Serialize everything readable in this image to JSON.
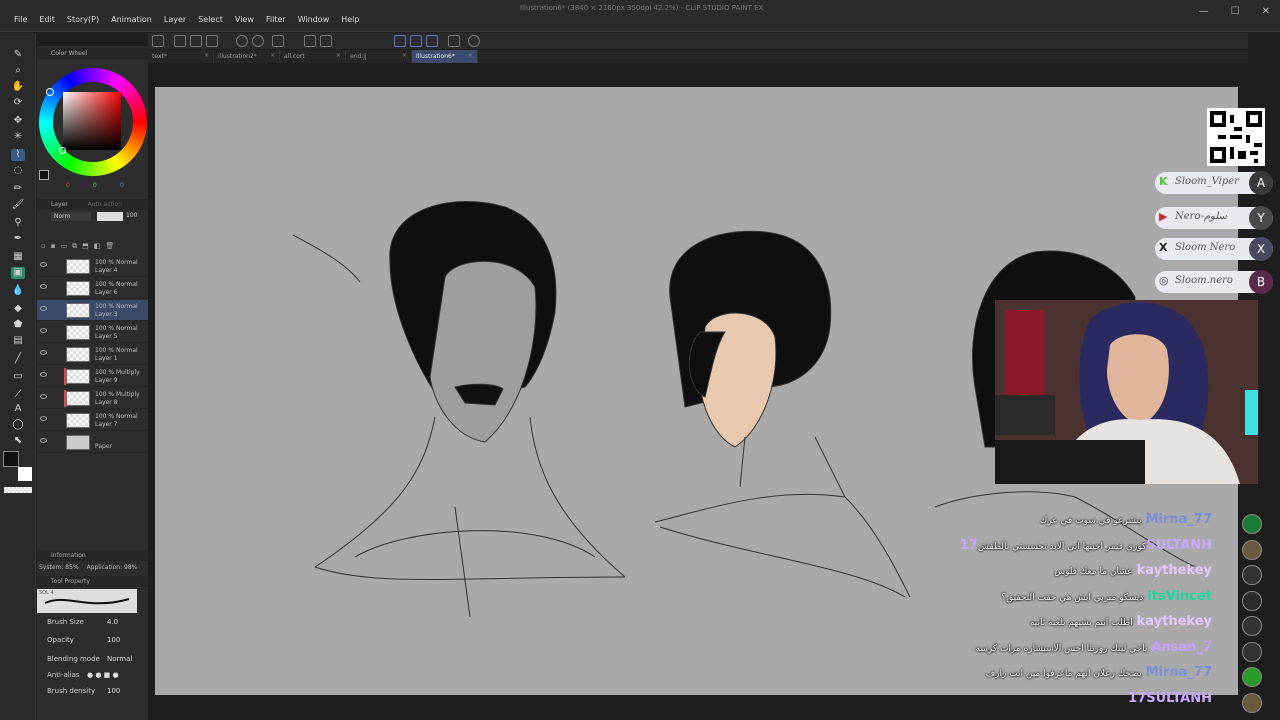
{
  "window": {
    "title": "Illustration6* (3840 × 2160px 350dpi 42.2%) - CLIP STUDIO PAINT EX"
  },
  "menu": [
    "File",
    "Edit",
    "Story(P)",
    "Animation",
    "Layer",
    "Select",
    "View",
    "Filter",
    "Window",
    "Help"
  ],
  "tabs": [
    {
      "label": "text*"
    },
    {
      "label": "illustration2*"
    },
    {
      "label": "all.cort"
    },
    {
      "label": "end.jj"
    },
    {
      "label": "Illustration6*"
    }
  ],
  "color_panel": {
    "title": "Color Wheel",
    "values": [
      "0",
      "0",
      "0"
    ],
    "main_color": "#1a1a1a",
    "sub_color": "#ffffff"
  },
  "layer_panel": {
    "tabs": [
      "Layer",
      "Auto action"
    ],
    "blend_mode": "Norm",
    "opacity": "100",
    "layers": [
      {
        "line1": "100 % Normal",
        "line2": "Layer 4"
      },
      {
        "line1": "100 % Normal",
        "line2": "Layer 6"
      },
      {
        "line1": "100 % Normal",
        "line2": "Layer 3",
        "selected": true
      },
      {
        "line1": "100 % Normal",
        "line2": "Layer 5"
      },
      {
        "line1": "100 % Normal",
        "line2": "Layer 1"
      },
      {
        "line1": "100 % Multiply",
        "line2": "Layer 9",
        "red": true
      },
      {
        "line1": "100 % Multiply",
        "line2": "Layer 8",
        "red": true
      },
      {
        "line1": "100 % Normal",
        "line2": "Layer 7"
      },
      {
        "line1": "",
        "line2": "Paper"
      }
    ]
  },
  "info_panel": {
    "title": "Information",
    "system_label": "System: 85%",
    "app_label": "Application: 98%"
  },
  "tool_property": {
    "title": "Tool Property",
    "brush_name": "SOL 4",
    "brush_size_label": "Brush Size",
    "brush_size": "4.0",
    "opacity_label": "Opacity",
    "opacity": "100",
    "blending_label": "Blending mode",
    "blending": "Normal",
    "antialias_label": "Anti-alias",
    "density_label": "Brush density",
    "density": "100"
  },
  "socials": [
    {
      "icon": "K",
      "handle": "Sloom_Viper",
      "badge": "A",
      "badge_color": "#3a3a3a"
    },
    {
      "icon": "▶",
      "handle": "Nero-سلوم",
      "badge": "Y",
      "badge_color": "#4a4a4a"
    },
    {
      "icon": "X",
      "handle": "Sloom Nero",
      "badge": "X",
      "badge_color": "#4a4a5e"
    },
    {
      "icon": "◎",
      "handle": "Sloom.nero",
      "badge": "B",
      "badge_color": "#5a2a4a"
    }
  ],
  "chat": [
    {
      "user": "Mirna_77",
      "user_color": "#7a8ed8",
      "text": "يتشرعو في سوت في عرك"
    },
    {
      "user": "17SULTANH",
      "user_color": "#c8a8ff",
      "text": "كوزي قيمز اخيتها اني الايد تحسستي بالطفش"
    },
    {
      "user": "kaythekey",
      "user_color": "#e0c8ff",
      "text": "عشان ما معك فلوس"
    },
    {
      "user": "itsVincet",
      "user_color": "#18d8a0",
      "text": "ديسكو متربي ايش هي حقت التحقيق؟"
    },
    {
      "user": "kaythekey",
      "user_color": "#e0c8ff",
      "text": "اطلب انتم بشيهم بلعبة ثانية"
    },
    {
      "user": "Ansan_7",
      "user_color": "#c8a0ff",
      "text": "ياخي ليتك روزتنا احس الاستشاره مرات كرسه"
    },
    {
      "user": "Mirna_77",
      "user_color": "#7a8ed8",
      "text": "يضحك زعلان انهم ماعرفوا مين انت زارف"
    },
    {
      "user": "17SULTANH",
      "user_color": "#c8a8ff",
      "text": ""
    }
  ]
}
